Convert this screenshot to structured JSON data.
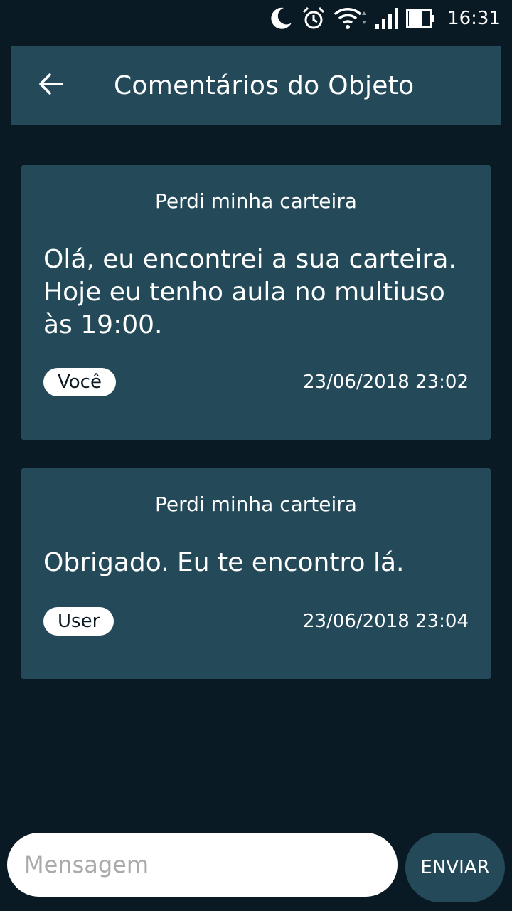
{
  "status_bar": {
    "time": "16:31",
    "icons": [
      "moon-icon",
      "alarm-icon",
      "wifi-icon",
      "signal-icon",
      "battery-icon"
    ]
  },
  "app_bar": {
    "back_icon": "arrow-left-icon",
    "title": "Comentários do Objeto"
  },
  "comments": [
    {
      "subject": "Perdi minha carteira",
      "message": "Olá, eu encontrei a sua carteira. Hoje eu tenho aula no multiuso às 19:00.",
      "author": "Você",
      "date": "23/06/2018 23:02"
    },
    {
      "subject": "Perdi minha carteira",
      "message": "Obrigado. Eu te encontro lá.",
      "author": "User",
      "date": "23/06/2018 23:04"
    }
  ],
  "composer": {
    "placeholder": "Mensagem",
    "value": "",
    "send_label": "ENVIAR"
  },
  "colors": {
    "background": "#0a1a24",
    "surface": "#244a5a",
    "chip": "#ffffff"
  }
}
